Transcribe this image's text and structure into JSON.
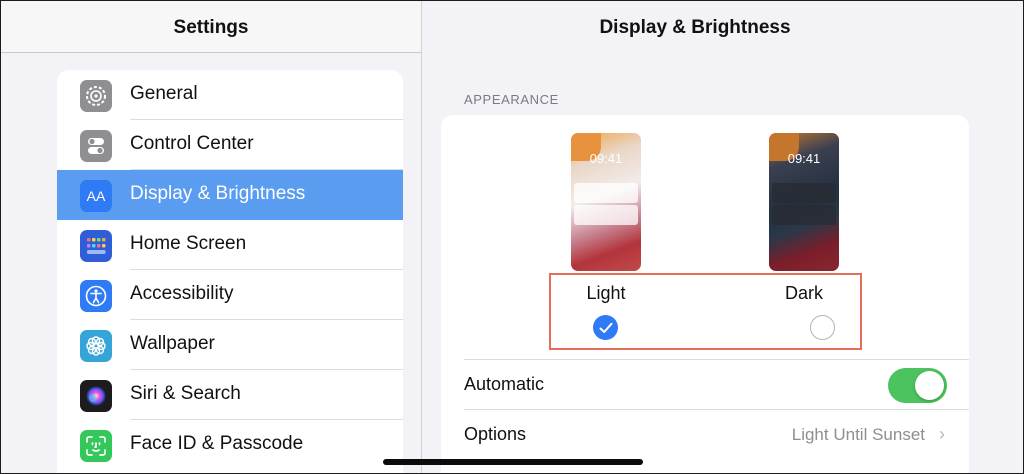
{
  "sidebar": {
    "title": "Settings",
    "items": [
      {
        "label": "General",
        "icon": "gear-icon",
        "color": "#8e8e93"
      },
      {
        "label": "Control Center",
        "icon": "switches-icon",
        "color": "#8e8e93"
      },
      {
        "label": "Display & Brightness",
        "icon": "text-size-icon",
        "color": "#2f7af5",
        "icon_text": "AA",
        "selected": true
      },
      {
        "label": "Home Screen",
        "icon": "app-grid-icon",
        "color": "#2f5fd8"
      },
      {
        "label": "Accessibility",
        "icon": "accessibility-icon",
        "color": "#2f7af5"
      },
      {
        "label": "Wallpaper",
        "icon": "flower-icon",
        "color": "#35a4d8"
      },
      {
        "label": "Siri & Search",
        "icon": "siri-icon",
        "color": "#1c1c1e"
      },
      {
        "label": "Face ID & Passcode",
        "icon": "face-id-icon",
        "color": "#34c759"
      }
    ]
  },
  "detail": {
    "title": "Display & Brightness",
    "section_label": "APPEARANCE",
    "light": {
      "time": "09:41",
      "label": "Light",
      "selected": true
    },
    "dark": {
      "time": "09:41",
      "label": "Dark",
      "selected": false
    },
    "automatic": {
      "label": "Automatic",
      "enabled": true
    },
    "options": {
      "label": "Options",
      "value": "Light Until Sunset",
      "chevron": "›"
    }
  },
  "colors": {
    "accent": "#2f7af5",
    "toggle_on": "#4cc35e",
    "highlight": "#e46e5a",
    "selected_row": "#5a9cf0"
  }
}
